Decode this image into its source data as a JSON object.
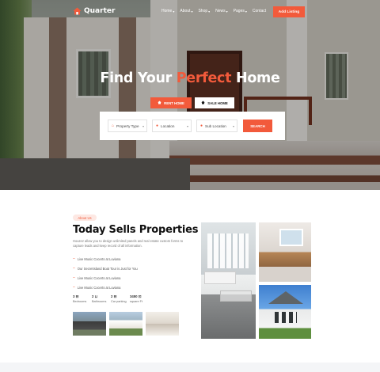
{
  "brand": {
    "name": "Quarter",
    "accent": "#f25a3b"
  },
  "nav": {
    "items": [
      {
        "label": "Home",
        "caret": "▾"
      },
      {
        "label": "About",
        "caret": "▾"
      },
      {
        "label": "Shop",
        "caret": "▾"
      },
      {
        "label": "News",
        "caret": "▾"
      },
      {
        "label": "Pages",
        "caret": "▾"
      },
      {
        "label": "Contact",
        "caret": ""
      }
    ],
    "cta": "Add Listing"
  },
  "hero": {
    "title_before": "Find Your ",
    "title_accent": "Perfect",
    "title_after": " Home",
    "tabs": [
      {
        "label": "RENT HOME",
        "icon": "home-icon"
      },
      {
        "label": "SALE HOME",
        "icon": "house-sale-icon"
      }
    ],
    "search": {
      "property_type": "Property Type",
      "location": "Location",
      "sub_location": "Sub Location",
      "button": "SEARCH"
    }
  },
  "about": {
    "badge": "About Us",
    "title": "Today Sells Properties",
    "description": "Houzez allow you to design unlimited panels and real estate custom forms to capture leads and keep record of all information.",
    "features": [
      "Live Music Cocerts at Luviana",
      "Our SecretIsland Boat Tour is Just for You",
      "Live Music Cocerts at Luviana",
      "Live Music Cocerts at Luviana"
    ],
    "stats": [
      {
        "num": "3 ⊟",
        "label": "Bedrooms"
      },
      {
        "num": "2 ⊔",
        "label": "Bathrooms"
      },
      {
        "num": "2 ⊟",
        "label": "Car parking"
      },
      {
        "num": "3450 ⊡",
        "label": "square Ft"
      }
    ]
  }
}
